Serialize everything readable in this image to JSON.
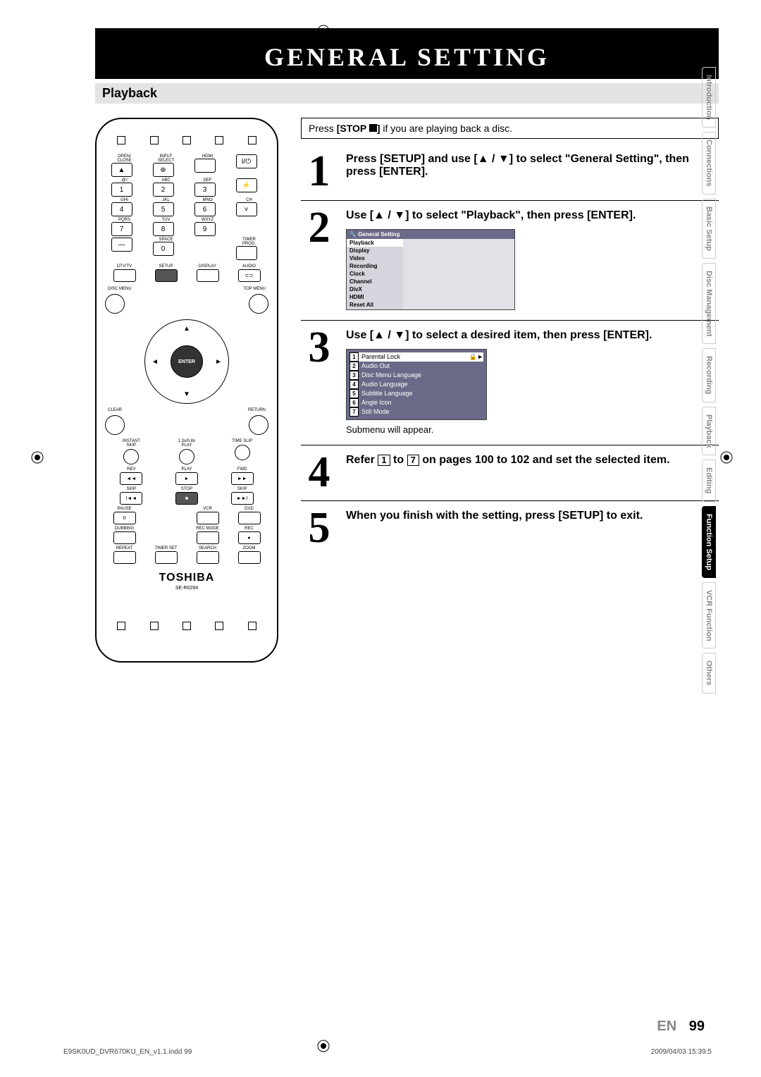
{
  "header": {
    "title": "GENERAL SETTING"
  },
  "section": {
    "title": "Playback"
  },
  "intro": {
    "prefix": "Press ",
    "bold": "[STOP ",
    "suffix": "] if you are playing back a disc."
  },
  "steps": {
    "s1": {
      "num": "1",
      "text": "Press [SETUP] and use [▲ / ▼] to select \"General Setting\", then press [ENTER]."
    },
    "s2": {
      "num": "2",
      "text": "Use [▲ / ▼] to select \"Playback\", then press [ENTER]."
    },
    "s3": {
      "num": "3",
      "text": "Use [▲ / ▼] to select a desired item, then press [ENTER].",
      "note": "Submenu will appear."
    },
    "s4": {
      "num": "4",
      "pre": "Refer ",
      "mid": " to ",
      "post": " on pages 100 to 102 and set the selected item.",
      "n1": "1",
      "n2": "7"
    },
    "s5": {
      "num": "5",
      "text": "When you finish with the setting, press [SETUP] to exit."
    }
  },
  "menu2": {
    "title": "General Setting",
    "items": [
      "Playback",
      "Display",
      "Video",
      "Recording",
      "Clock",
      "Channel",
      "DivX",
      "HDMI",
      "Reset All"
    ]
  },
  "menu3": {
    "items": [
      {
        "n": "1",
        "label": "Parental Lock"
      },
      {
        "n": "2",
        "label": "Audio Out"
      },
      {
        "n": "3",
        "label": "Disc Menu Language"
      },
      {
        "n": "4",
        "label": "Audio Language"
      },
      {
        "n": "5",
        "label": "Subtitle Language"
      },
      {
        "n": "6",
        "label": "Angle Icon"
      },
      {
        "n": "7",
        "label": "Still Mode"
      }
    ]
  },
  "remote": {
    "brand": "TOSHIBA",
    "model": "SE-R0294",
    "row1": [
      "OPEN/\nCLOSE",
      "INPUT\nSELECT",
      "HDMI",
      ""
    ],
    "num1": [
      ".@/:",
      "ABC",
      "DEF"
    ],
    "num2": [
      "GHI",
      "JKL",
      "MNO"
    ],
    "num3": [
      "PQRS",
      "TUV",
      "WXYZ"
    ],
    "num4": [
      "",
      "SPACE",
      ""
    ],
    "keys1": [
      "1",
      "2",
      "3"
    ],
    "keys2": [
      "4",
      "5",
      "6"
    ],
    "keys3": [
      "7",
      "8",
      "9"
    ],
    "keys4": [
      "—",
      "0",
      ""
    ],
    "ch": "CH",
    "timer": "TIMER\nPROG.",
    "row5": [
      "DTV/TV",
      "SETUP",
      "DISPLAY",
      "AUDIO"
    ],
    "discmenu": "DISC MENU",
    "topmenu": "TOP MENU",
    "enter": "ENTER",
    "clear": "CLEAR",
    "return": "RETURN",
    "instant": "INSTANT\nSKIP",
    "playlbl": "1.3x/0.8x\nPLAY",
    "timeslip": "TIME SLIP",
    "rev": "REV",
    "play": "PLAY",
    "fwd": "FWD",
    "skip": "SKIP",
    "stop": "STOP",
    "pause": "PAUSE",
    "vcr": "VCR",
    "dvd": "DVD",
    "dubbing": "DUBBING",
    "recmode": "REC MODE",
    "rec": "REC",
    "repeat": "REPEAT",
    "timerset": "TIMER SET",
    "search": "SEARCH",
    "zoom": "ZOOM"
  },
  "tabs": [
    "Introduction",
    "Connections",
    "Basic Setup",
    "Disc\nManagement",
    "Recording",
    "Playback",
    "Editing",
    "Function Setup",
    "VCR Function",
    "Others"
  ],
  "footer": {
    "lang": "EN",
    "page": "99",
    "file": "E9SK0UD_DVR670KU_EN_v1.1.indd   99",
    "date": "2009/04/03   15:39:5"
  }
}
